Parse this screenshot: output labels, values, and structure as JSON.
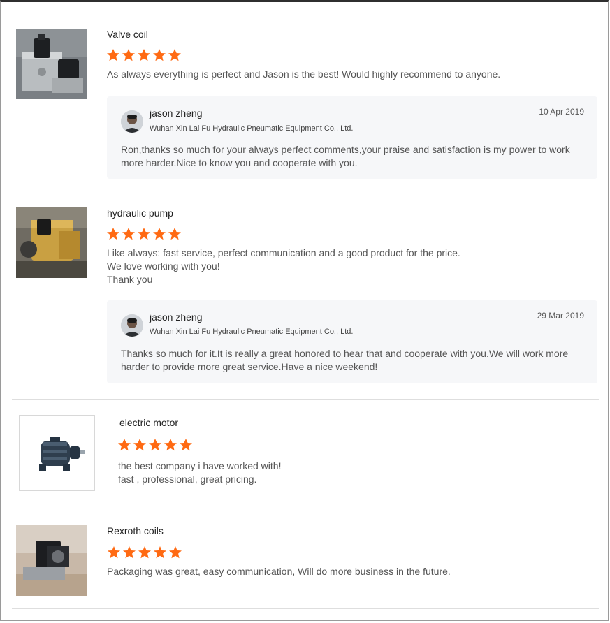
{
  "colors": {
    "star": "#ff6a13",
    "reply_bg": "#f6f7f9",
    "divider": "#dedede"
  },
  "reviews": [
    {
      "product": "Valve coil",
      "rating": 5,
      "text": [
        "As always everything is perfect and Jason is the best! Would highly recommend to anyone."
      ],
      "image_icon": "valve-coil-photo",
      "reply": {
        "name": "jason zheng",
        "company": "Wuhan Xin Lai Fu Hydraulic Pneumatic Equipment Co., Ltd.",
        "date": "10 Apr 2019",
        "text": [
          "Ron,thanks so much for your always perfect comments,your praise and satisfaction is my power to work",
          "more harder.Nice to know you and cooperate with you."
        ]
      }
    },
    {
      "product": "hydraulic pump",
      "rating": 5,
      "text": [
        "Like always: fast service, perfect communication and a good product for the price.",
        "We love working with you!",
        "Thank you"
      ],
      "image_icon": "hydraulic-pump-photo",
      "reply": {
        "name": "jason zheng",
        "company": "Wuhan Xin Lai Fu Hydraulic Pneumatic Equipment Co., Ltd.",
        "date": "29 Mar 2019",
        "text": [
          "Thanks so much for it.It is really a great honored to hear that and cooperate with you.We will work more",
          "harder to provide more great service.Have a nice weekend!"
        ]
      }
    },
    {
      "product": "electric motor",
      "rating": 5,
      "text": [
        "the best company i have worked with!",
        "fast , professional, great pricing."
      ],
      "image_icon": "electric-motor-photo"
    },
    {
      "product": "Rexroth coils",
      "rating": 5,
      "text": [
        "Packaging was great, easy communication, Will do more business in the future."
      ],
      "image_icon": "rexroth-coils-photo"
    }
  ]
}
